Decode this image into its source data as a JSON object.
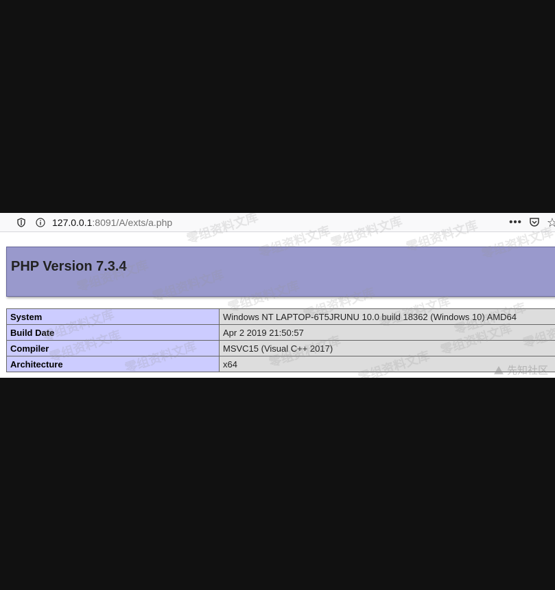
{
  "browser": {
    "url_host": "127.0.0.1",
    "url_rest": ":8091/A/exts/a.php",
    "more_label": "•••"
  },
  "php": {
    "title": "PHP Version 7.3.4",
    "rows": [
      {
        "key": "System",
        "value": "Windows NT LAPTOP-6T5JRUNU 10.0 build 18362 (Windows 10) AMD64"
      },
      {
        "key": "Build Date",
        "value": "Apr 2 2019 21:50:57"
      },
      {
        "key": "Compiler",
        "value": "MSVC15 (Visual C++ 2017)"
      },
      {
        "key": "Architecture",
        "value": "x64"
      }
    ]
  },
  "watermarks": {
    "text": "零组资料文库",
    "logo_text": "先知社区"
  }
}
